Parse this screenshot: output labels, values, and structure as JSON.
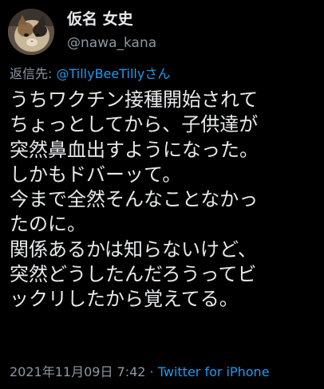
{
  "user": {
    "display_name": "仮名 女史",
    "handle": "@nawa_kana"
  },
  "reply": {
    "prefix": "返信先: ",
    "target": "@TillyBeeTillyさん"
  },
  "tweet": {
    "lines": [
      "うちワクチン接種開始されて",
      "ちょっとしてから、子供達が",
      "突然鼻血出すようになった。",
      "しかもドバーッて。",
      "今まで全然そんなことなかっ",
      "たのに。",
      "関係あるかは知らないけど、",
      "突然どうしたんだろうってビ",
      "ックリしたから覚えてる。"
    ]
  },
  "meta": {
    "timestamp": "2021年11月09日 7:42",
    "separator": " · ",
    "source": "Twitter for iPhone"
  },
  "colors": {
    "background": "#000000",
    "primary_text": "#e7e9ea",
    "secondary_text": "#8b98a5",
    "accent": "#1d9bf0"
  },
  "icons": {
    "avatar": "cat-avatar"
  }
}
